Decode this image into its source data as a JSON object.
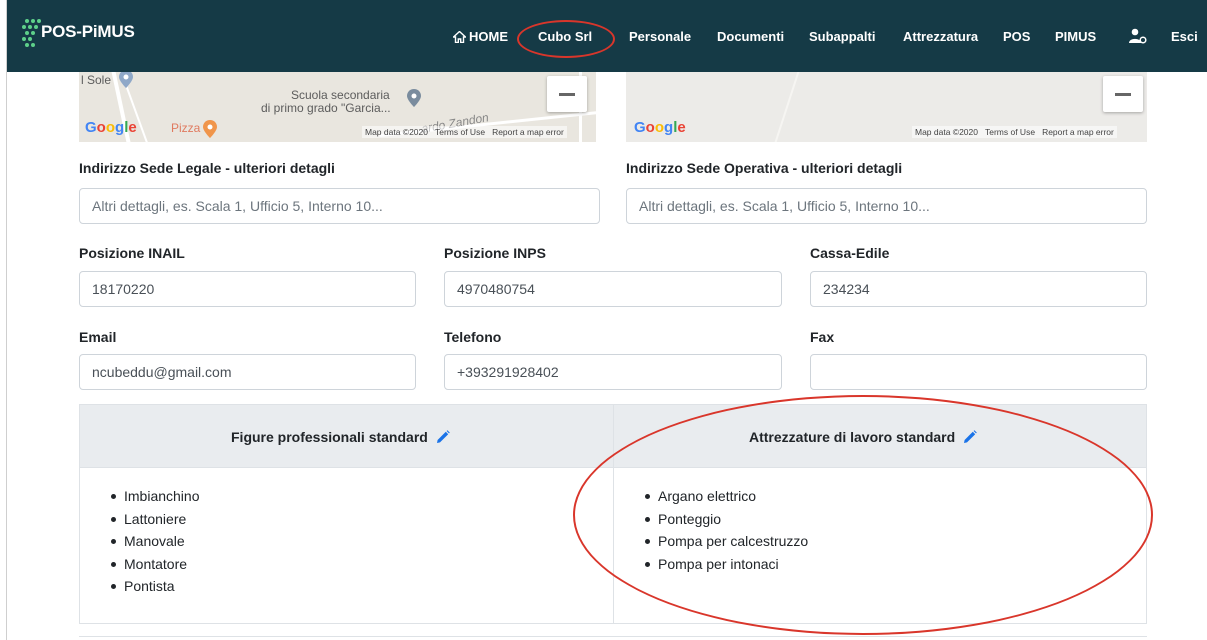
{
  "navbar": {
    "brand": "POS-PiMUS",
    "home": "HOME",
    "company": "Cubo Srl",
    "items": [
      "Personale",
      "Documenti",
      "Subappalti",
      "Attrezzatura",
      "POS",
      "PIMUS"
    ],
    "logout": "Esci",
    "background": "#153a46"
  },
  "map_left": {
    "place1": "l Sole",
    "place2": "Scuola secondaria",
    "place3": "di primo grado \"Garcia...",
    "street": "ardo Zandon",
    "poi": "Pizza",
    "footer": [
      "Map data ©2020",
      "Terms of Use",
      "Report a map error"
    ]
  },
  "map_right": {
    "footer": [
      "Map data ©2020",
      "Terms of Use",
      "Report a map error"
    ]
  },
  "google_logo": "Google",
  "form": {
    "legal_label": "Indirizzo Sede Legale - ulteriori detagli",
    "legal_placeholder": "Altri dettagli, es. Scala 1, Ufficio 5, Interno 10...",
    "operative_label": "Indirizzo Sede Operativa - ulteriori detagli",
    "operative_placeholder": "Altri dettagli, es. Scala 1, Ufficio 5, Interno 10...",
    "inail_label": "Posizione INAIL",
    "inail_value": "18170220",
    "inps_label": "Posizione INPS",
    "inps_value": "4970480754",
    "cassa_label": "Cassa-Edile",
    "cassa_value": "234234",
    "email_label": "Email",
    "email_value": "ncubeddu@gmail.com",
    "phone_label": "Telefono",
    "phone_value": "+393291928402",
    "fax_label": "Fax",
    "fax_value": ""
  },
  "table": {
    "col1_header": "Figure professionali standard",
    "col2_header": "Attrezzature di lavoro standard",
    "professionals": [
      "Imbianchino",
      "Lattoniere",
      "Manovale",
      "Montatore",
      "Pontista"
    ],
    "equipment": [
      "Argano elettrico",
      "Ponteggio",
      "Pompa per calcestruzzo",
      "Pompa per intonaci"
    ]
  },
  "colors": {
    "annotation": "#d9362b",
    "edit_icon": "#1a73e8"
  }
}
